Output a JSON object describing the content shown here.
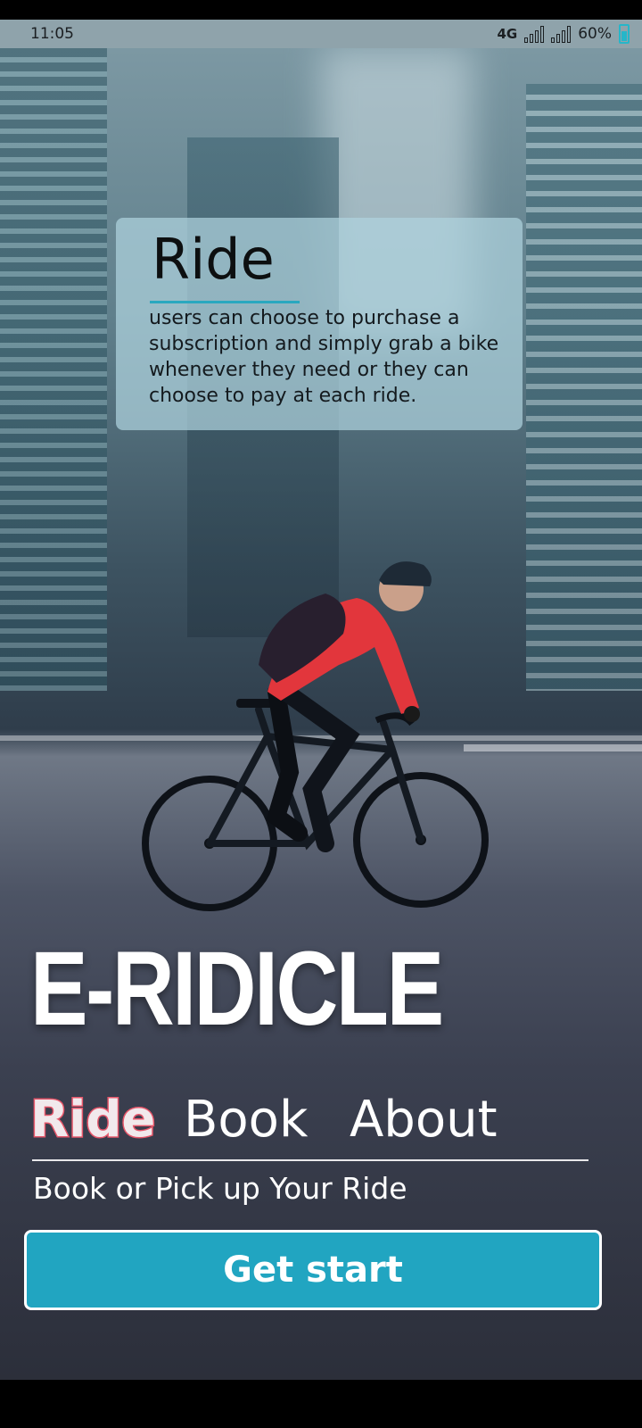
{
  "status_bar": {
    "time": "11:05",
    "network": "4G",
    "battery": "60%",
    "battery_color": "#26b6c9"
  },
  "info_card": {
    "title": "Ride",
    "text": "users can choose to purchase a subscription and simply grab a bike whenever they need or they can choose to pay at each ride."
  },
  "brand": {
    "name": "E-RIDICLE"
  },
  "tabs": [
    {
      "label": "Ride",
      "active": true
    },
    {
      "label": "Book",
      "active": false
    },
    {
      "label": "About",
      "active": false
    }
  ],
  "subtitle": "Book or Pick up Your Ride",
  "cta": {
    "label": "Get start",
    "color": "#21a5c1"
  },
  "icons": {
    "signal": "signal-icon",
    "battery": "battery-icon"
  }
}
